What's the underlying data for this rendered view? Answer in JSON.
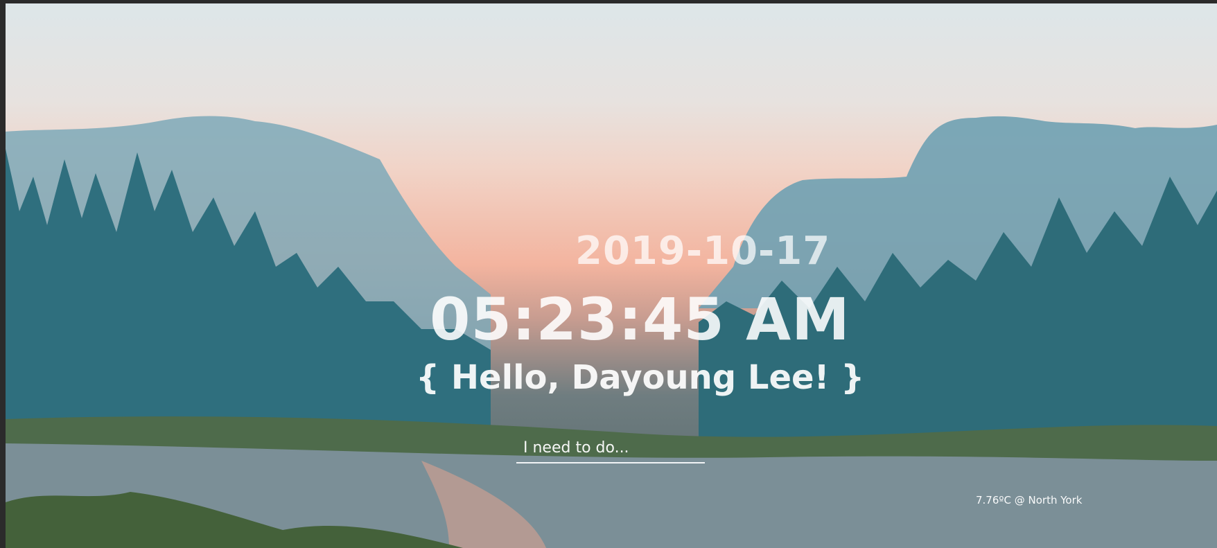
{
  "clock": {
    "date": "2019-10-17",
    "time": "05:23:45 AM"
  },
  "greeting": {
    "text": "{ Hello, Dayoung Lee! }"
  },
  "todo": {
    "placeholder": "I need to do...",
    "value": ""
  },
  "weather": {
    "temperature": "7.76ºC",
    "separator": "@",
    "location": "North York"
  },
  "background": {
    "subject": "valley-landscape-image"
  }
}
